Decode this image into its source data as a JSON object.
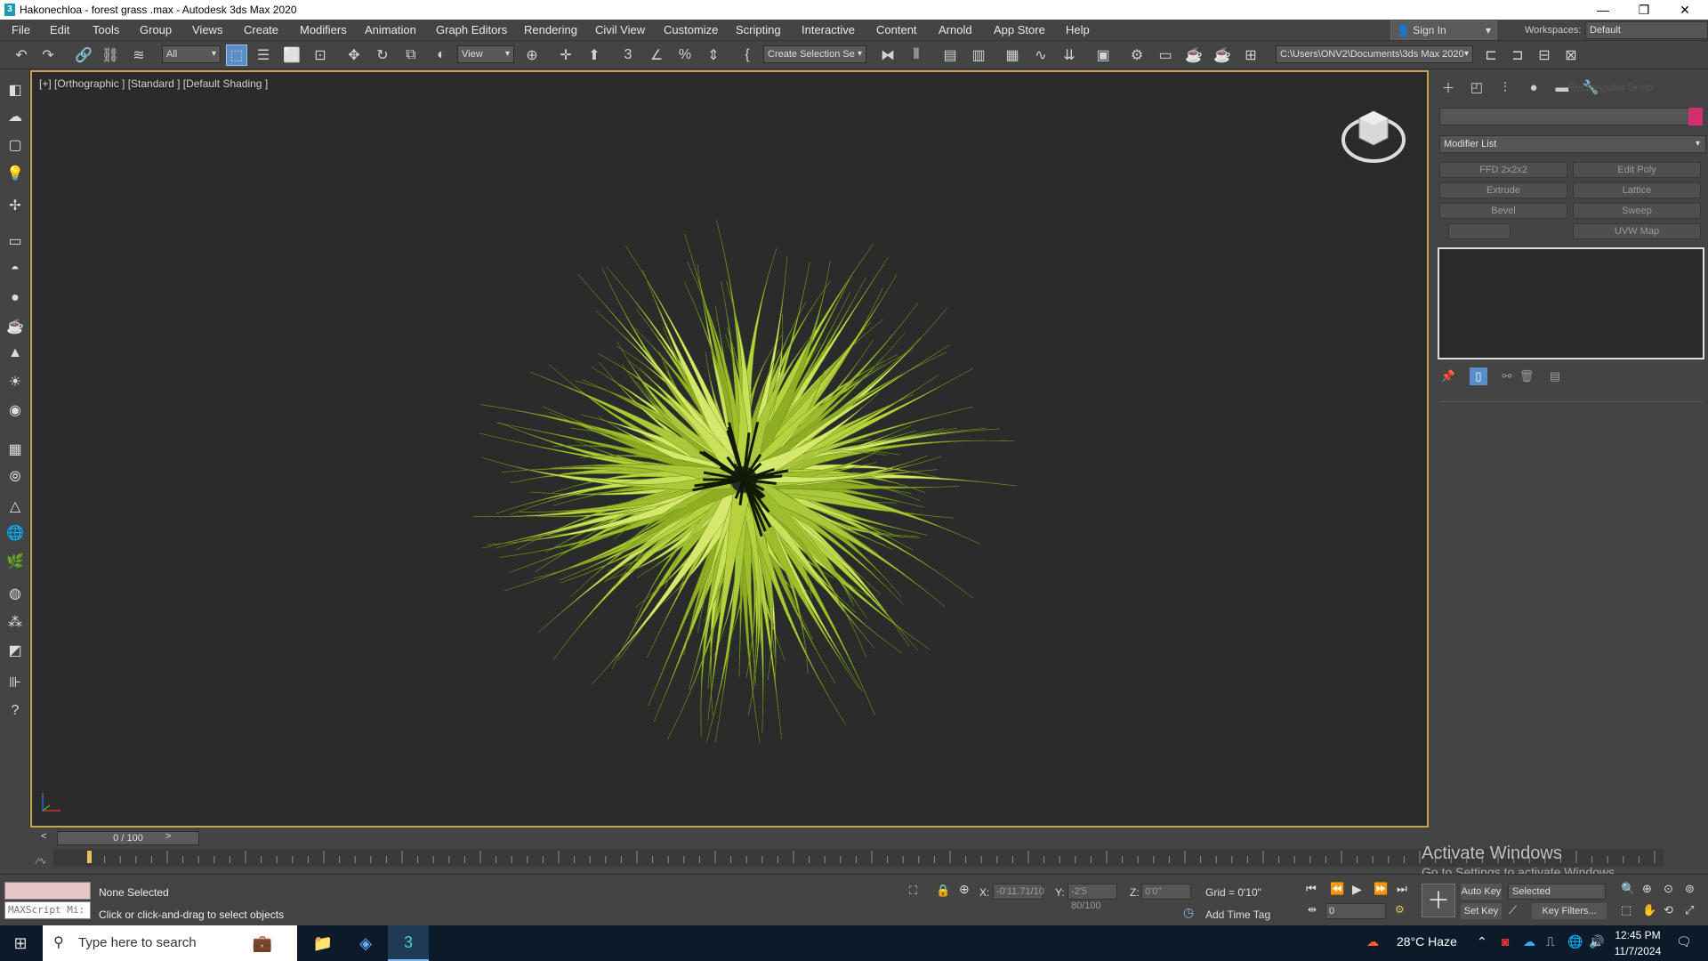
{
  "window": {
    "title": "Hakonechloa - forest grass .max - Autodesk 3ds Max 2020",
    "app_icon": "3"
  },
  "menu": [
    "File",
    "Edit",
    "Tools",
    "Group",
    "Views",
    "Create",
    "Modifiers",
    "Animation",
    "Graph Editors",
    "Rendering",
    "Civil View",
    "Customize",
    "Scripting",
    "Interactive",
    "Content",
    "Arnold",
    "App Store",
    "Help"
  ],
  "account": {
    "sign_in": "Sign In",
    "workspaces_label": "Workspaces:",
    "workspace": "Default"
  },
  "toolbar": {
    "filter": "All",
    "ref_coord": "View",
    "selection_set": "Create Selection Se",
    "project_path": "C:\\Users\\ONV2\\Documents\\3ds Max 2020"
  },
  "viewport": {
    "label": "[+] [Orthographic ] [Standard ] [Default Shading ]"
  },
  "command_panel": {
    "overlay_text": "Rectangular Snap",
    "modifier_list": "Modifier List",
    "buttons": [
      "FFD 2x2x2",
      "Edit Poly",
      "Extrude",
      "Lattice",
      "Bevel",
      "Sweep",
      "",
      "UVW Map"
    ],
    "accent_color": "#d1306e"
  },
  "timeline": {
    "frame": "0 / 100",
    "prev": "<",
    "next": ">"
  },
  "activation": {
    "title": "Activate Windows",
    "subtitle": "Go to Settings to activate Windows."
  },
  "status": {
    "selection": "None Selected",
    "prompt": "Click or click-and-drag to select objects",
    "maxscript": "MAXScript Mi:",
    "x_label": "X:",
    "x_value": "-0'11.71/10",
    "y_label": "Y:",
    "y_value": "-2'5 80/100",
    "z_label": "Z:",
    "z_value": "0'0\"",
    "grid": "Grid = 0'10\"",
    "add_time_tag": "Add Time Tag",
    "auto_key": "Auto Key",
    "set_key": "Set Key",
    "key_mode": "Selected",
    "key_filters": "Key Filters...",
    "frame_value": "0"
  },
  "taskbar": {
    "search_placeholder": "Type here to search",
    "weather": "28°C  Haze",
    "time": "12:45 PM",
    "date": "11/7/2024"
  }
}
